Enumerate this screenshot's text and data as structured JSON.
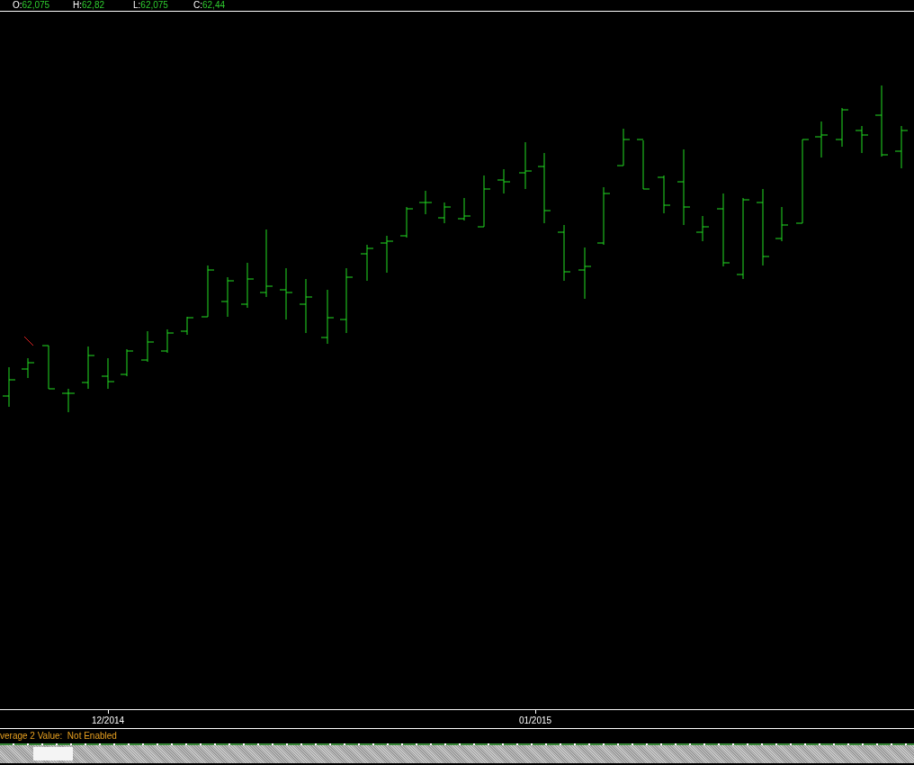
{
  "quote": [
    {
      "label": "O:",
      "value": "62,075"
    },
    {
      "label": "H:",
      "value": "62,82"
    },
    {
      "label": "L:",
      "value": "62,075"
    },
    {
      "label": "C:",
      "value": "62,44"
    }
  ],
  "time_axis": {
    "labels": [
      "12/2014",
      "01/2015"
    ]
  },
  "status_bar": {
    "text": "verage 2 Value:  Not Enabled"
  }
}
